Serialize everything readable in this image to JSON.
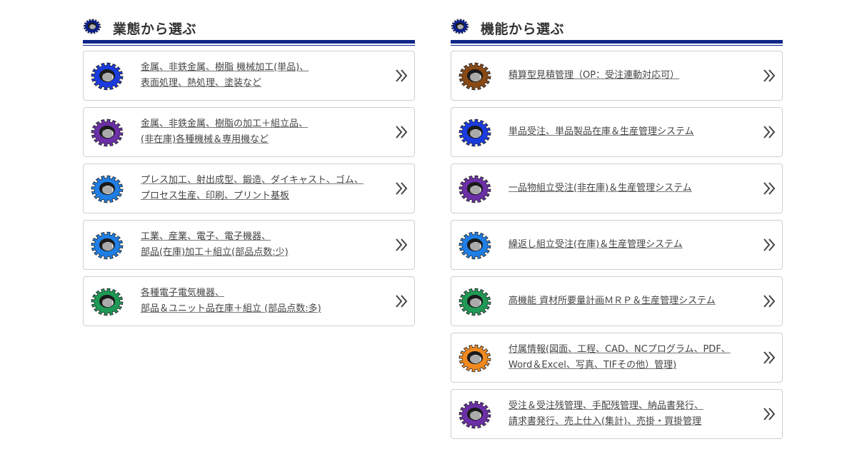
{
  "colors": {
    "header_rule": "#10268a",
    "gear_navy": "#0b1f8c",
    "gear_brown": "#8a4a14",
    "gear_blue": "#1a3be0",
    "gear_purple": "#6b2fa8",
    "gear_sky": "#1f7fe6",
    "gear_green": "#1f9a55",
    "gear_orange": "#f08a1f"
  },
  "left": {
    "title": "業態から選ぶ",
    "icon": "gear-icon",
    "items": [
      {
        "lines": [
          "金属、非鉄金属、樹脂 機械加工(単品)、",
          "表面処理、熱処理、塗装など"
        ],
        "gear_color": "#1a3be0"
      },
      {
        "lines": [
          "金属、非鉄金属、樹脂の加工＋組立品、",
          "(非在庫)各種機械＆専用機など"
        ],
        "gear_color": "#6b2fa8"
      },
      {
        "lines": [
          "プレス加工、射出成型、鍛造、ダイキャスト、ゴム、",
          "プロセス生産、印刷、プリント基板"
        ],
        "gear_color": "#1f7fe6"
      },
      {
        "lines": [
          "工業、産業、電子、電子機器、",
          "部品(在庫)加工＋組立(部品点数:少)"
        ],
        "gear_color": "#1f7fe6"
      },
      {
        "lines": [
          "各種電子電気機器、",
          "部品＆ユニット品在庫＋組立 (部品点数:多)"
        ],
        "gear_color": "#1f9a55"
      }
    ]
  },
  "right": {
    "title": "機能から選ぶ",
    "icon": "gear-icon",
    "items": [
      {
        "lines": [
          "積算型見積管理（OP：受注連動対応可）"
        ],
        "gear_color": "#8a4a14"
      },
      {
        "lines": [
          "単品受注、単品製品在庫＆生産管理システム"
        ],
        "gear_color": "#1a3be0"
      },
      {
        "lines": [
          "一品物組立受注(非在庫)＆生産管理システム"
        ],
        "gear_color": "#6b2fa8"
      },
      {
        "lines": [
          "繰返し組立受注(在庫)＆生産管理システム"
        ],
        "gear_color": "#1f7fe6"
      },
      {
        "lines": [
          "高機能 資材所要量計画ＭＲＰ＆生産管理システム"
        ],
        "gear_color": "#1f9a55"
      },
      {
        "lines": [
          "付属情報(図面、工程、CAD、NCプログラム、PDF、",
          "Word＆Excel、写真、TIFその他）管理)"
        ],
        "gear_color": "#f08a1f"
      },
      {
        "lines": [
          "受注＆受注残管理、手配残管理、納品書発行、",
          "請求書発行、売上仕入(集計)、売掛・買掛管理"
        ],
        "gear_color": "#6b2fa8"
      }
    ]
  }
}
